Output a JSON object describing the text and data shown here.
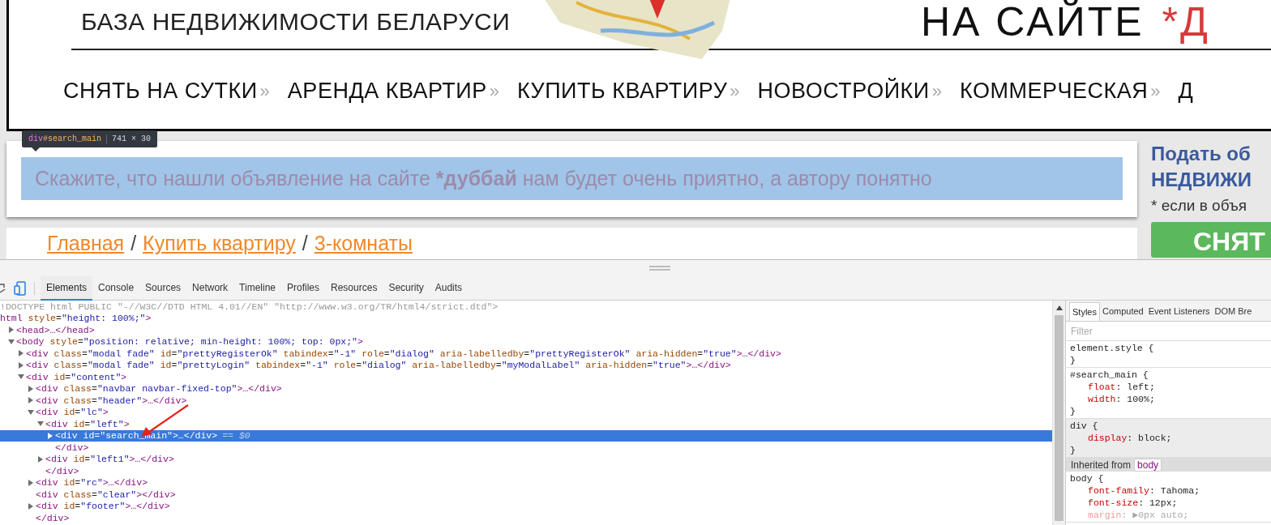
{
  "page": {
    "header": {
      "tagline": "БАЗА НЕДВИЖИМОСТИ БЕЛАРУСИ",
      "slogan": "НА САЙТЕ",
      "slogan_mark": "*Д"
    },
    "nav": [
      {
        "label": "СНЯТЬ НА СУТКИ",
        "separator": "»"
      },
      {
        "label": "АРЕНДА КВАРТИР",
        "separator": "»"
      },
      {
        "label": "КУПИТЬ КВАРТИРУ",
        "separator": "»"
      },
      {
        "label": "НОВОСТРОЙКИ",
        "separator": "»"
      },
      {
        "label": "КОММЕРЧЕСКАЯ",
        "separator": "»"
      },
      {
        "label": "Д"
      }
    ],
    "inspect_tooltip": {
      "selector_tag": "div",
      "selector_id": "#search_main",
      "size": "741 × 30"
    },
    "banner": {
      "before": "Скажите, что нашли объявление на сайте ",
      "bold": "*дуббай",
      "after": " нам будет очень приятно, а автору понятно"
    },
    "breadcrumb": [
      {
        "kind": "link",
        "text": "Главная"
      },
      {
        "kind": "sep",
        "text": "/"
      },
      {
        "kind": "link",
        "text": "Купить квартиру"
      },
      {
        "kind": "sep",
        "text": "/"
      },
      {
        "kind": "link",
        "text": "3-комнаты"
      }
    ],
    "sidebar": {
      "title_1": "Подать об",
      "title_2": "НЕДВИЖИ",
      "note": "* если в объя",
      "button": "СНЯТ"
    }
  },
  "devtools": {
    "tabs": [
      {
        "label": "Elements",
        "selected": true
      },
      {
        "label": "Console",
        "selected": false
      },
      {
        "label": "Sources",
        "selected": false
      },
      {
        "label": "Network",
        "selected": false
      },
      {
        "label": "Timeline",
        "selected": false
      },
      {
        "label": "Profiles",
        "selected": false
      },
      {
        "label": "Resources",
        "selected": false
      },
      {
        "label": "Security",
        "selected": false
      },
      {
        "label": "Audits",
        "selected": false
      }
    ],
    "doctype": "!DOCTYPE html PUBLIC \"-//W3C//DTD HTML 4.01//EN\" \"http://www.w3.org/TR/html4/strict.dtd\">",
    "dom_tree": [
      {
        "text": "html style=\"height: 100%;\">",
        "selected": false,
        "children": [
          {
            "text": "<head>…</head>",
            "expanded": false,
            "selected": false
          },
          {
            "text": "<body style=\"position: relative; min-height: 100%; top: 0px;\">",
            "expanded": true,
            "selected": false,
            "children": [
              {
                "text": "<div class=\"modal fade\" id=\"prettyRegisterOk\" tabindex=\"-1\" role=\"dialog\" aria-labelledby=\"prettyRegisterOk\" aria-hidden=\"true\">…</div>",
                "expanded": false,
                "selected": false
              },
              {
                "text": "<div class=\"modal fade\" id=\"prettyLogin\" tabindex=\"-1\" role=\"dialog\" aria-labelledby=\"myModalLabel\" aria-hidden=\"true\">…</div>",
                "expanded": false,
                "selected": false
              },
              {
                "text": "<div id=\"content\">",
                "expanded": true,
                "selected": false,
                "children": [
                  {
                    "text": "<div class=\"navbar navbar-fixed-top\">…</div>",
                    "expanded": false,
                    "selected": false
                  },
                  {
                    "text": "<div class=\"header\">…</div>",
                    "expanded": false,
                    "selected": false
                  },
                  {
                    "text": "<div id=\"lc\">",
                    "expanded": true,
                    "selected": false,
                    "children": [
                      {
                        "text": "<div id=\"left\">",
                        "expanded": true,
                        "selected": false,
                        "children": [
                          {
                            "text": "<div id=\"search_main\">…</div>",
                            "suffix": "== $0",
                            "expanded": false,
                            "selected": true
                          },
                          {
                            "text": "</div>",
                            "selected": false
                          }
                        ]
                      },
                      {
                        "text": "<div id=\"left1\">…</div>",
                        "expanded": false,
                        "selected": false
                      },
                      {
                        "text": "</div>",
                        "selected": false
                      }
                    ]
                  },
                  {
                    "text": "<div id=\"rc\">…</div>",
                    "expanded": false,
                    "selected": false
                  },
                  {
                    "text": "<div class=\"clear\"></div>",
                    "selected": false
                  },
                  {
                    "text": "<div id=\"footer\">…</div>",
                    "expanded": false,
                    "selected": false
                  },
                  {
                    "text": "</div>",
                    "selected": false
                  }
                ]
              }
            ]
          }
        ]
      }
    ],
    "styles_pane": {
      "tabs": [
        {
          "label": "Styles",
          "selected": true
        },
        {
          "label": "Computed",
          "selected": false
        },
        {
          "label": "Event Listeners",
          "selected": false
        },
        {
          "label": "DOM Bre",
          "selected": false
        }
      ],
      "filter": {
        "placeholder": "Filter"
      },
      "rules": [
        {
          "selector": "element.style {",
          "close": "}",
          "shaded": false
        },
        {
          "selector": "#search_main {",
          "properties": [
            {
              "text": "float: left;",
              "inactive": false
            },
            {
              "text": "width: 100%;",
              "inactive": false
            }
          ],
          "close": "}",
          "shaded": false
        },
        {
          "selector": "div {",
          "properties": [
            {
              "text": "display: block;",
              "inactive": false
            }
          ],
          "close": "}",
          "shaded": true
        }
      ],
      "inherited": {
        "label": "Inherited from",
        "source": "body"
      },
      "inherited_rules": [
        {
          "selector": "body {",
          "properties": [
            {
              "text": "font-family: Tahoma;",
              "inactive": false
            },
            {
              "text": "font-size: 12px;",
              "inactive": false
            },
            {
              "text": "margin: ▶0px auto;",
              "inactive": true
            }
          ],
          "shaded": false
        }
      ]
    }
  }
}
